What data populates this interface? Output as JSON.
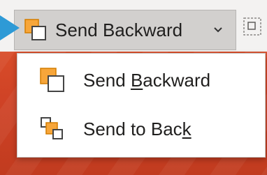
{
  "ribbon": {
    "split_button": {
      "label": "Send Backward",
      "icon": "send-backward-icon",
      "chevron_icon": "chevron-down-icon"
    },
    "adjacent_icon": "group-objects-icon"
  },
  "menu": {
    "items": [
      {
        "label_before": "Send ",
        "label_accel": "B",
        "label_after": "ackward",
        "icon": "send-backward-icon"
      },
      {
        "label_before": "Send to Bac",
        "label_accel": "k",
        "label_after": "",
        "icon": "send-to-back-icon"
      }
    ]
  },
  "colors": {
    "accent_orange": "#f7a63a",
    "icon_outline": "#444444",
    "selected_bg": "#d2d0ce",
    "background": "#d24726",
    "cursor": "#2e9ad6"
  }
}
